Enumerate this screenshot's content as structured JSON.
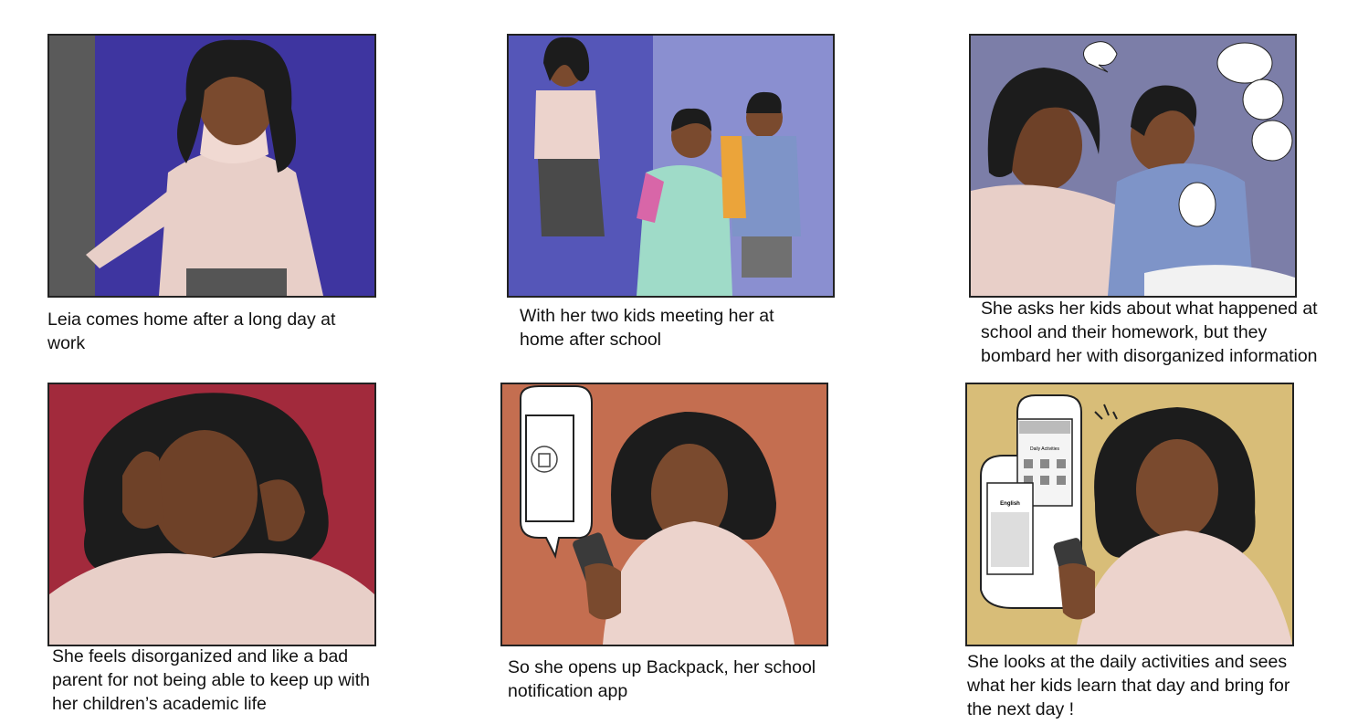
{
  "storyboard": {
    "panels": [
      {
        "caption": "Leia comes home after a long day at\nwork",
        "background": "#3e35a0"
      },
      {
        "caption": "With her two kids meeting her at\nhome after school",
        "background": "#8a8fd0"
      },
      {
        "caption": "She asks her kids about what happened at\nschool and their homework, but they\nbombard her with disorganized information",
        "background": "#7c7ea8"
      },
      {
        "caption": "She feels disorganized and like a bad\nparent for not being able to keep up with\nher children’s academic life",
        "background": "#a22a3c"
      },
      {
        "caption": "So she opens up Backpack, her school\nnotification app",
        "background": "#c46e50"
      },
      {
        "caption": "She looks at the daily activities and sees\nwhat her kids learn that day and bring for\nthe next day !",
        "background": "#d8bd78"
      }
    ],
    "phone_screen": {
      "header": "Daily Activities",
      "card_title": "English"
    }
  }
}
